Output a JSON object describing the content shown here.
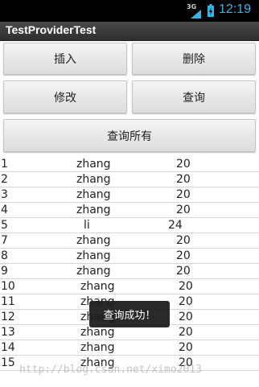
{
  "status_bar": {
    "network": "3G",
    "time": "12:19"
  },
  "app": {
    "title": "TestProviderTest"
  },
  "buttons": {
    "insert": "插入",
    "delete": "删除",
    "edit": "修改",
    "query": "查询",
    "query_all": "查询所有"
  },
  "rows": [
    {
      "id": "1",
      "name": "zhang",
      "age": "20"
    },
    {
      "id": "2",
      "name": "zhang",
      "age": "20"
    },
    {
      "id": "3",
      "name": "zhang",
      "age": "20"
    },
    {
      "id": "4",
      "name": "zhang",
      "age": "20"
    },
    {
      "id": "5",
      "name": "li",
      "age": "24"
    },
    {
      "id": "7",
      "name": "zhang",
      "age": "20"
    },
    {
      "id": "8",
      "name": "zhang",
      "age": "20"
    },
    {
      "id": "9",
      "name": "zhang",
      "age": "20"
    },
    {
      "id": "10",
      "name": "zhang",
      "age": "20"
    },
    {
      "id": "11",
      "name": "zhang",
      "age": "20"
    },
    {
      "id": "12",
      "name": "zhang",
      "age": "20"
    },
    {
      "id": "13",
      "name": "zhang",
      "age": "20"
    },
    {
      "id": "14",
      "name": "zhang",
      "age": "20"
    },
    {
      "id": "15",
      "name": "zhang",
      "age": "20"
    }
  ],
  "toast": {
    "message": "查询成功！"
  },
  "watermark": "http://blog.csdn.net/ximo2013"
}
